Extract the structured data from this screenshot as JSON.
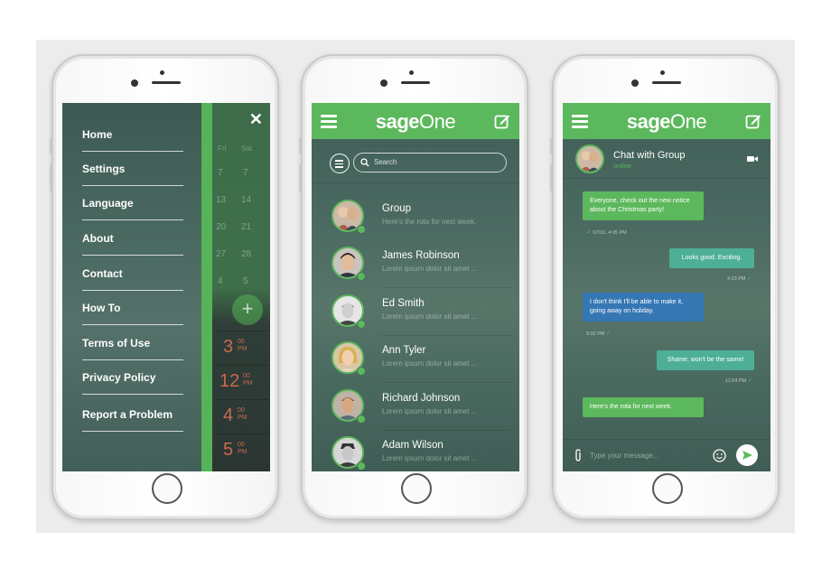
{
  "menu": {
    "items": [
      "Home",
      "Settings",
      "Language",
      "About",
      "Contact",
      "How To",
      "Terms of Use",
      "Privacy Policy",
      "Report a Problem"
    ],
    "close_icon": "close-icon"
  },
  "calendar": {
    "headers": [
      "Fri",
      "Sat"
    ],
    "rows": [
      [
        "7",
        "7"
      ],
      [
        "13",
        "14"
      ],
      [
        "20",
        "21"
      ],
      [
        "27",
        "28"
      ],
      [
        "4",
        "5"
      ]
    ],
    "times": [
      {
        "hour": "3",
        "min": "00",
        "ampm": "PM"
      },
      {
        "hour": "12",
        "min": "00",
        "ampm": "PM"
      },
      {
        "hour": "4",
        "min": "00",
        "ampm": "PM"
      },
      {
        "hour": "5",
        "min": "00",
        "ampm": "PM"
      }
    ]
  },
  "brand": {
    "bold": "sage",
    "light": "One"
  },
  "search": {
    "placeholder": "Search"
  },
  "contacts": [
    {
      "name": "Group",
      "message": "Here's the rota for next week."
    },
    {
      "name": "James Robinson",
      "message": "Lorem ipsum dolor sit amet ..."
    },
    {
      "name": "Ed Smith",
      "message": "Lorem ipsum dolor sit amet ..."
    },
    {
      "name": "Ann Tyler",
      "message": "Lorem ipsum dolor sit amet ..."
    },
    {
      "name": "Richard Johnson",
      "message": "Lorem ipsum dolor sit amet ..."
    },
    {
      "name": "Adam Wilson",
      "message": "Lorem ipsum dolor sit amet ..."
    }
  ],
  "chat": {
    "title": "Chat with Group",
    "status": "online",
    "messages": [
      {
        "text": "Everyone, check out the new notice about the Christmas party!",
        "time": "07/10, 4:05 PM"
      },
      {
        "text": "Looks good. Exciting.",
        "time": "4:23 PM"
      },
      {
        "text": "I don't think I'll be able to make it, going away on holiday.",
        "time": "9:02 PM"
      },
      {
        "text": "Shame, won't be the same!",
        "time": "11:04 PM"
      },
      {
        "text": "Here's the rota for next week.",
        "time": ""
      }
    ],
    "input_placeholder": "Type your message..."
  },
  "colors": {
    "brand_green": "#5cb85c",
    "teal": "#4daf97",
    "blue": "#3577b3",
    "time_orange": "#c96a4e"
  }
}
